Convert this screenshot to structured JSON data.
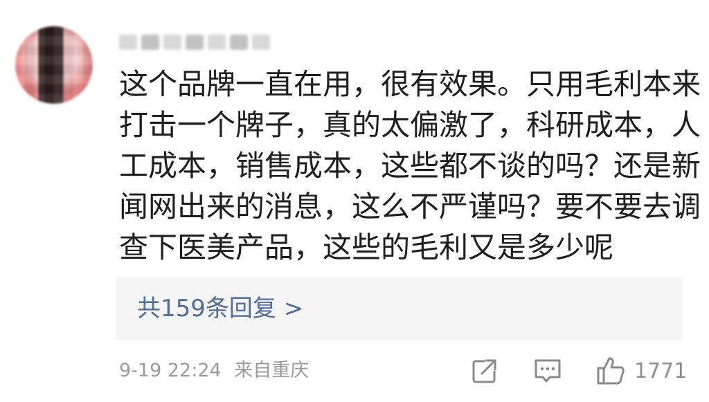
{
  "comment": {
    "lines": [
      "这个品牌一直在用，很有效果。只用毛利本来",
      "打击一个牌子，真的太偏激了，科研成本，人",
      "工成本，销售成本，这些都不谈的吗？还是新",
      "闻网出来的消息，这么不严谨吗？要不要去调",
      "查下医美产品，这些的毛利又是多少呢"
    ]
  },
  "replies": {
    "label": "共159条回复 >"
  },
  "meta": {
    "time": "9-19 22:24",
    "location": "来自重庆"
  },
  "actions": {
    "share_icon": "share-icon",
    "comment_icon": "comment-icon",
    "like_icon": "thumbs-up-icon",
    "like_count": "1771"
  }
}
